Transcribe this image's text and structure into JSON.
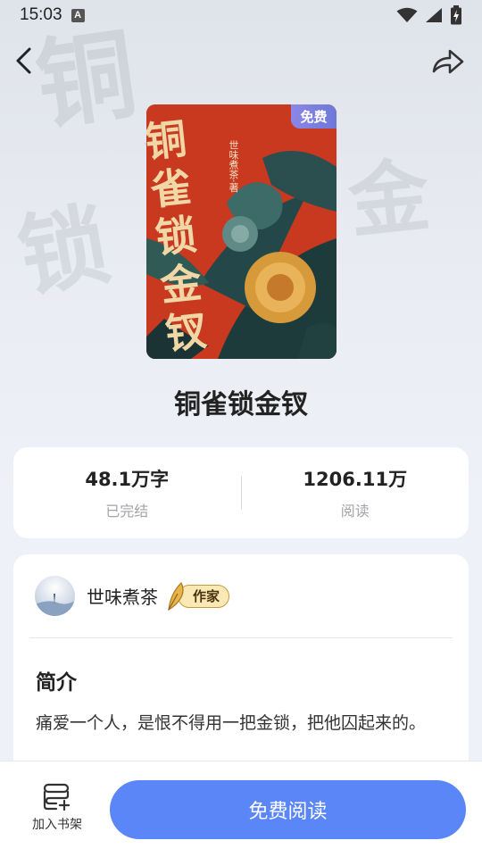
{
  "status_bar": {
    "time": "15:03",
    "notification_badge": "A",
    "icons": [
      "wifi-icon",
      "signal-icon",
      "battery-charging-icon"
    ]
  },
  "nav": {
    "back_icon": "chevron-left-icon",
    "share_icon": "share-icon"
  },
  "book": {
    "title": "铜雀锁金钗",
    "cover_badge": "免费",
    "cover_calligraphy": "铜雀锁金钗",
    "cover_author_vertical": "世味煮茶·著"
  },
  "stats": {
    "word_count": "48.1万字",
    "status": "已完结",
    "read_count": "1206.11万",
    "read_label": "阅读"
  },
  "author": {
    "name": "世味煮茶",
    "tag": "作家"
  },
  "intro": {
    "heading": "简介",
    "text": "痛爱一个人，是恨不得用一把金锁，把他囚起来的。"
  },
  "bottom_bar": {
    "shelf_label": "加入书架",
    "read_button_label": "免费阅读"
  },
  "colors": {
    "accent": "#5b86f7",
    "badge": "#7d7fe0",
    "cover_red": "#c53a21",
    "page_bg": "#eef1f7"
  }
}
